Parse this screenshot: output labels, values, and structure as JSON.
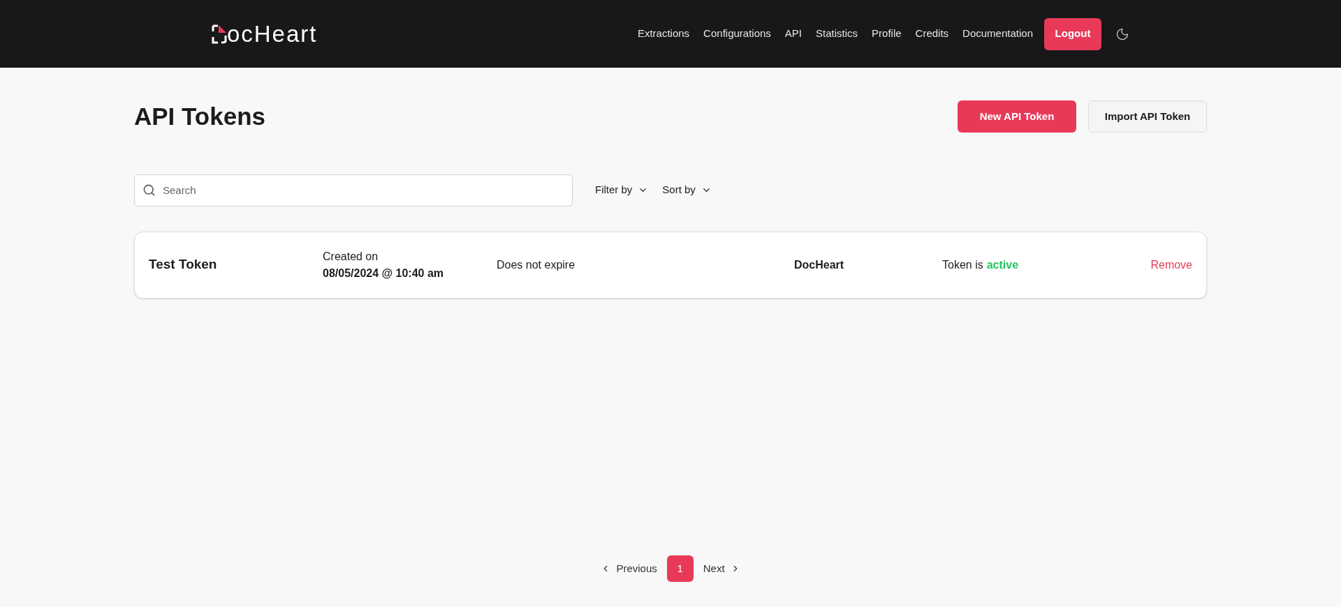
{
  "header": {
    "logo_text": "ocHeart",
    "nav": [
      "Extractions",
      "Configurations",
      "API",
      "Statistics",
      "Profile",
      "Credits",
      "Documentation"
    ],
    "logout": "Logout"
  },
  "page": {
    "title": "API Tokens",
    "new_button": "New API Token",
    "import_button": "Import API Token"
  },
  "toolbar": {
    "search": {
      "placeholder": "Search"
    },
    "filter": "Filter by",
    "sort": "Sort by"
  },
  "tokens": [
    {
      "name": "Test Token",
      "created_label": "Created on",
      "created": "08/05/2024 @ 10:40 am",
      "expiry": "Does not expire",
      "owner": "DocHeart",
      "status_prefix": "Token is",
      "status": "active",
      "active": true,
      "action": "Remove"
    }
  ],
  "pagination": {
    "previous": "Previous",
    "next": "Next",
    "pages": [
      {
        "label": "1",
        "selected": true
      }
    ]
  }
}
